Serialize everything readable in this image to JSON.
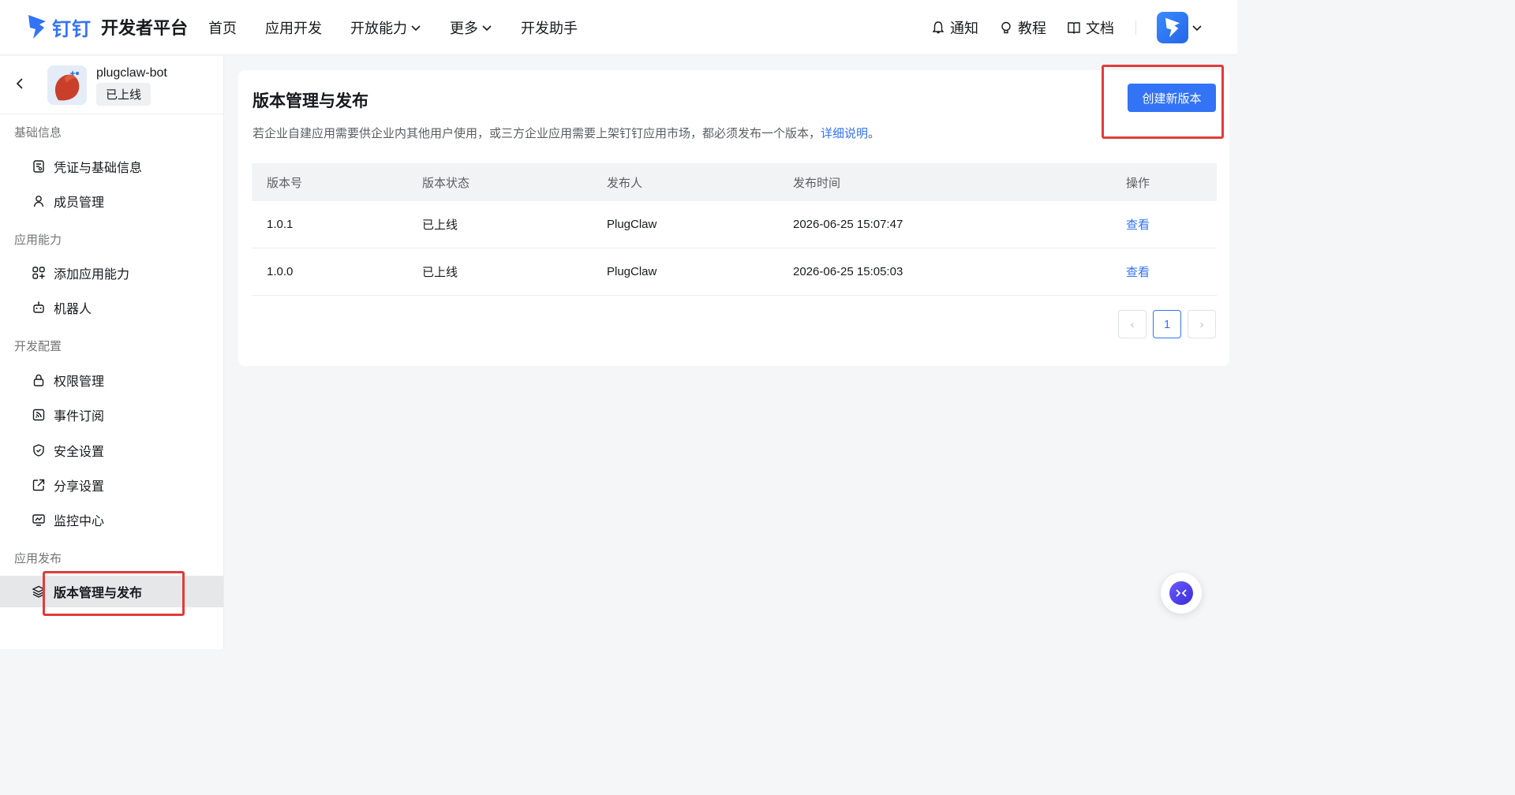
{
  "header": {
    "brand": "钉钉",
    "platform_title": "开发者平台",
    "nav": [
      {
        "label": "首页",
        "has_dropdown": false
      },
      {
        "label": "应用开发",
        "has_dropdown": false
      },
      {
        "label": "开放能力",
        "has_dropdown": true
      },
      {
        "label": "更多",
        "has_dropdown": true
      },
      {
        "label": "开发助手",
        "has_dropdown": false
      }
    ],
    "tools": [
      {
        "label": "通知",
        "icon": "bell-icon"
      },
      {
        "label": "教程",
        "icon": "lightbulb-icon"
      },
      {
        "label": "文档",
        "icon": "book-icon"
      }
    ]
  },
  "sidebar": {
    "app_name": "plugclaw-bot",
    "app_status": "已上线",
    "groups": [
      {
        "title": "基础信息",
        "items": [
          {
            "label": "凭证与基础信息",
            "icon": "credential-icon"
          },
          {
            "label": "成员管理",
            "icon": "user-icon"
          }
        ]
      },
      {
        "title": "应用能力",
        "items": [
          {
            "label": "添加应用能力",
            "icon": "apps-icon"
          },
          {
            "label": "机器人",
            "icon": "robot-icon"
          }
        ]
      },
      {
        "title": "开发配置",
        "items": [
          {
            "label": "权限管理",
            "icon": "lock-icon"
          },
          {
            "label": "事件订阅",
            "icon": "rss-icon"
          },
          {
            "label": "安全设置",
            "icon": "shield-icon"
          },
          {
            "label": "分享设置",
            "icon": "share-icon"
          },
          {
            "label": "监控中心",
            "icon": "monitor-icon"
          }
        ]
      },
      {
        "title": "应用发布",
        "items": [
          {
            "label": "版本管理与发布",
            "icon": "layers-icon",
            "active": true
          }
        ]
      }
    ]
  },
  "main": {
    "title": "版本管理与发布",
    "description": "若企业自建应用需要供企业内其他用户使用，或三方企业应用需要上架钉钉应用市场，都必须发布一个版本，",
    "description_link": "详细说明",
    "description_end": "。",
    "create_button": "创建新版本",
    "table": {
      "headers": [
        "版本号",
        "版本状态",
        "发布人",
        "发布时间",
        "操作"
      ],
      "rows": [
        {
          "version": "1.0.1",
          "status": "已上线",
          "publisher": "PlugClaw",
          "time": "2026-06-25 15:07:47",
          "action": "查看"
        },
        {
          "version": "1.0.0",
          "status": "已上线",
          "publisher": "PlugClaw",
          "time": "2026-06-25 15:05:03",
          "action": "查看"
        }
      ]
    },
    "pagination": {
      "prev": "‹",
      "current": "1",
      "next": "›"
    }
  },
  "colors": {
    "accent": "#3373f5",
    "annotation": "#e23b3b"
  }
}
